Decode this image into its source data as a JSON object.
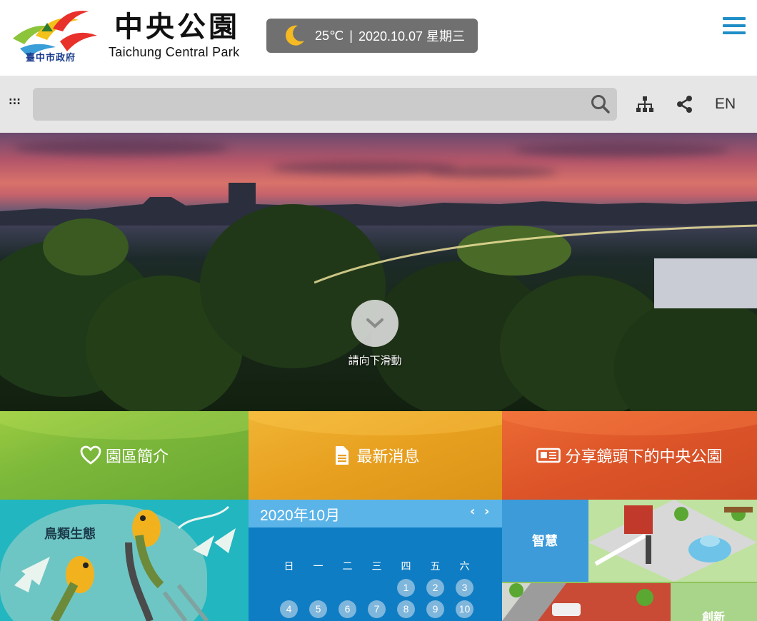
{
  "header": {
    "logo_gov_text": "臺中市政府",
    "brand_title": "中央公園",
    "brand_subtitle": "Taichung Central Park",
    "weather": {
      "icon": "moon-icon",
      "temperature": "25℃",
      "separator": "|",
      "date": "2020.10.07 星期三"
    },
    "menu_icon": "hamburger-icon"
  },
  "toolbar": {
    "accesskey": ":::",
    "search_placeholder": "",
    "icons": [
      "search-icon",
      "sitemap-icon",
      "share-icon"
    ],
    "lang": "EN"
  },
  "hero": {
    "scroll_label": "請向下滑動",
    "scroll_icon": "chevron-down-icon"
  },
  "tiles": [
    {
      "label": "園區簡介",
      "icon": "heart-icon",
      "color": "#7cb83a"
    },
    {
      "label": "最新消息",
      "icon": "document-icon",
      "color": "#e8a020"
    },
    {
      "label": "分享鏡頭下的中央公園",
      "icon": "newspaper-icon",
      "color": "#dc5428"
    }
  ],
  "birds_panel": {
    "title": "鳥類生態"
  },
  "calendar": {
    "title": "2020年10月",
    "prev": "‹",
    "next": "›",
    "weekdays": [
      "日",
      "一",
      "二",
      "三",
      "四",
      "五",
      "六"
    ],
    "weeks": [
      [
        "",
        "",
        "",
        "",
        "1",
        "2",
        "3"
      ],
      [
        "4",
        "5",
        "6",
        "7",
        "8",
        "9",
        "10"
      ]
    ]
  },
  "smart_panel": {
    "label_top": "智慧",
    "label_bottom": "創新"
  }
}
